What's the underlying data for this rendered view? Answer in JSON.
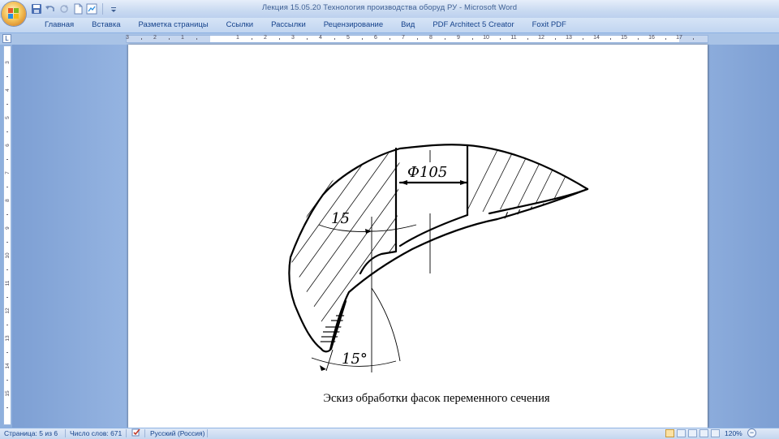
{
  "window": {
    "title": "Лекция 15.05.20 Технология производства оборуд РУ - Microsoft Word"
  },
  "quick_access": {
    "items": [
      "save-icon",
      "undo-icon",
      "redo-icon",
      "new-document-icon",
      "print-preview-icon",
      "customize-icon"
    ]
  },
  "ribbon": {
    "tabs": [
      {
        "label": "Главная"
      },
      {
        "label": "Вставка"
      },
      {
        "label": "Разметка страницы"
      },
      {
        "label": "Ссылки"
      },
      {
        "label": "Рассылки"
      },
      {
        "label": "Рецензирование"
      },
      {
        "label": "Вид"
      },
      {
        "label": "PDF Architect 5 Creator"
      },
      {
        "label": "Foxit PDF"
      }
    ]
  },
  "ruler": {
    "tab_selector": "L",
    "horizontal_labels": [
      "3",
      "2",
      "1",
      "1",
      "2",
      "3",
      "4",
      "5",
      "6",
      "7",
      "8",
      "9",
      "10",
      "11",
      "12",
      "13",
      "14",
      "15",
      "16",
      "17"
    ],
    "vertical_labels": [
      "3",
      "4",
      "5",
      "6",
      "7",
      "8",
      "9",
      "10",
      "11",
      "12",
      "13",
      "14",
      "15",
      "16",
      "17",
      "18",
      "19"
    ]
  },
  "document": {
    "sketch": {
      "dimension_top": "Ф105",
      "dimension_left": "15",
      "angle_bottom": "15°"
    },
    "caption": "Эскиз обработки фасок переменного сечения"
  },
  "status": {
    "page": "Страница: 5 из 6",
    "words": "Число слов: 671",
    "language": "Русский (Россия)",
    "zoom": "120%"
  },
  "colors": {
    "ribbon_text": "#15428b",
    "window_background": "#8fb0dd",
    "page": "#ffffff"
  }
}
